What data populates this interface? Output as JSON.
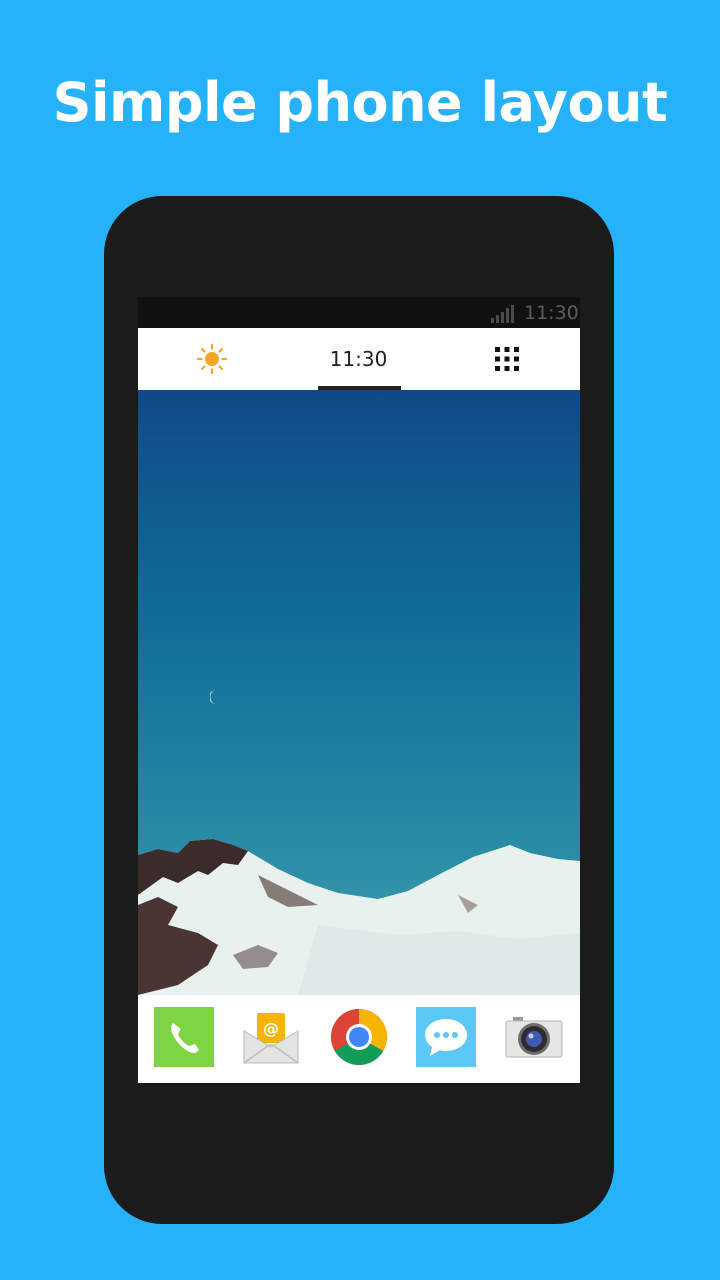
{
  "headline": "Simple phone layout",
  "status_bar": {
    "time": "11:30",
    "signal_icon": "signal-icon"
  },
  "tab_bar": {
    "tabs": [
      {
        "icon": "sun-icon"
      },
      {
        "label": "11:30"
      },
      {
        "icon": "app-grid-icon"
      }
    ],
    "selected_index": 1
  },
  "dock": {
    "apps": [
      {
        "icon": "phone-icon",
        "color": "#7ed442"
      },
      {
        "icon": "email-icon",
        "color": "#f4b400"
      },
      {
        "icon": "chrome-icon",
        "color": "#db4437"
      },
      {
        "icon": "messages-icon",
        "color": "#5bc8f5"
      },
      {
        "icon": "camera-icon",
        "color": "#e6e6e6"
      }
    ]
  },
  "colors": {
    "background": "#25b2fb",
    "phone_body": "#1b1b1b",
    "sun": "#f6a623"
  }
}
